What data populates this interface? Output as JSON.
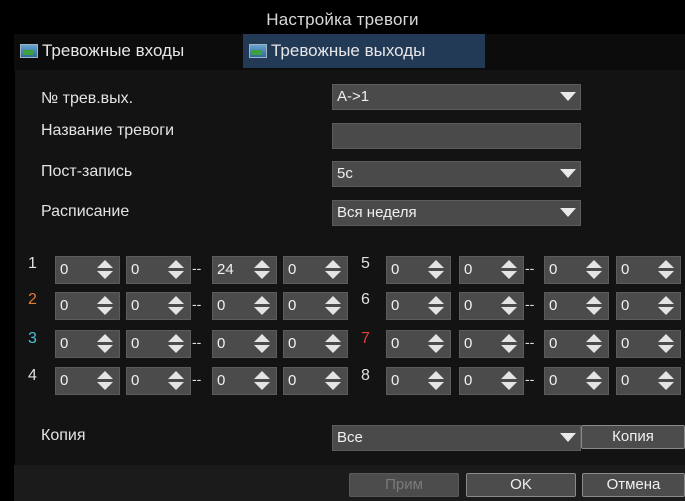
{
  "window": {
    "title": "Настройка тревоги"
  },
  "tabs": [
    {
      "label": "Тревожные входы",
      "icon": "picture-icon",
      "active": false
    },
    {
      "label": "Тревожные выходы",
      "icon": "picture-icon",
      "active": true
    }
  ],
  "form": {
    "output_no": {
      "label": "№ трев.вых.",
      "value": "A->1"
    },
    "alarm_name": {
      "label": "Название тревоги",
      "value": ""
    },
    "post_record": {
      "label": "Пост-запись",
      "value": "5с"
    },
    "schedule": {
      "label": "Расписание",
      "value": "Вся неделя"
    }
  },
  "time_slots": [
    {
      "num": "1",
      "color": "#e0e0e0",
      "start_h": "0",
      "start_m": "0",
      "end_h": "24",
      "end_m": "0"
    },
    {
      "num": "2",
      "color": "#e57b2d",
      "start_h": "0",
      "start_m": "0",
      "end_h": "0",
      "end_m": "0"
    },
    {
      "num": "3",
      "color": "#48c2d6",
      "start_h": "0",
      "start_m": "0",
      "end_h": "0",
      "end_m": "0"
    },
    {
      "num": "4",
      "color": "#e0e0e0",
      "start_h": "0",
      "start_m": "0",
      "end_h": "0",
      "end_m": "0"
    },
    {
      "num": "5",
      "color": "#e0e0e0",
      "start_h": "0",
      "start_m": "0",
      "end_h": "0",
      "end_m": "0"
    },
    {
      "num": "6",
      "color": "#e0e0e0",
      "start_h": "0",
      "start_m": "0",
      "end_h": "0",
      "end_m": "0"
    },
    {
      "num": "7",
      "color": "#e23d3d",
      "start_h": "0",
      "start_m": "0",
      "end_h": "0",
      "end_m": "0"
    },
    {
      "num": "8",
      "color": "#e0e0e0",
      "start_h": "0",
      "start_m": "0",
      "end_h": "0",
      "end_m": "0"
    }
  ],
  "copy": {
    "label": "Копия",
    "value": "Все",
    "button": "Копия"
  },
  "footer": {
    "apply": "Прим",
    "ok": "OK",
    "cancel": "Отмена"
  }
}
